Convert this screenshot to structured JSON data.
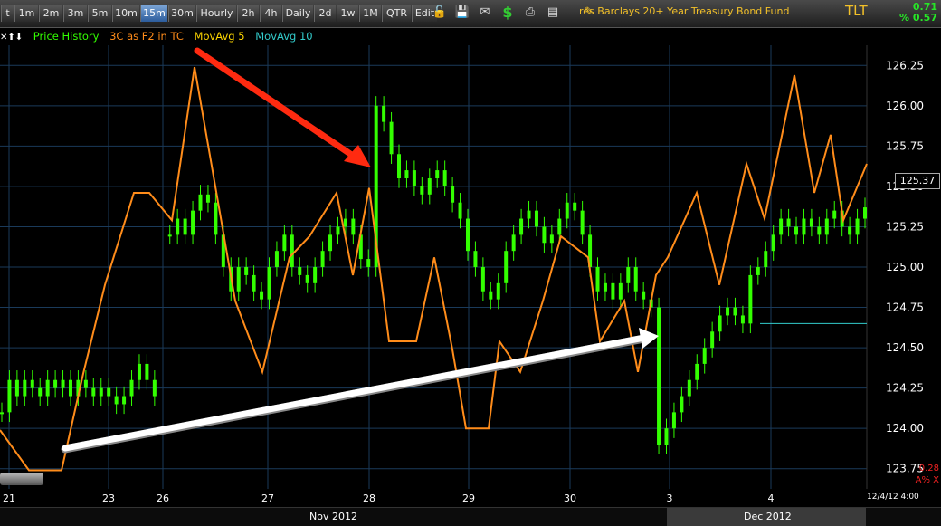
{
  "toolbar": {
    "timeframes": [
      "t",
      "1m",
      "2m",
      "3m",
      "5m",
      "10m",
      "15m",
      "30m",
      "Hourly",
      "2h",
      "4h",
      "Daily",
      "2d",
      "1w",
      "1M",
      "QTR",
      "Edit"
    ],
    "active": "15m",
    "icons": [
      "lock-icon",
      "save-icon",
      "mail-icon",
      "dollar-icon",
      "print-icon",
      "page-icon",
      "pencil-icon"
    ],
    "fund_name": "res Barclays 20+ Year Treasury Bond Fund",
    "symbol": "TLT",
    "change_value": "0.71",
    "change_percent": "% 0.57"
  },
  "legend": {
    "arrows": "✕⬆⬇",
    "price": "Price History",
    "indicator": "3C as F2 in TC",
    "ma5": "MovAvg 5",
    "ma10": "MovAvg 10"
  },
  "colors": {
    "price_up": "#33ff00",
    "indicator": "#ff8c1a",
    "ma5": "#ffd700",
    "ma10": "#33cccc",
    "grid": "#1a3a5a",
    "red_arrow": "#ff2a10",
    "white_arrow": "#ffffff"
  },
  "chart_data": {
    "type": "line",
    "y_ticks": [
      "126.25",
      "126.00",
      "125.75",
      "125.50",
      "125.25",
      "125.00",
      "124.75",
      "124.50",
      "124.25",
      "124.00",
      "123.75"
    ],
    "ylim": [
      123.625,
      126.375
    ],
    "x_ticks": [
      "21",
      "23",
      "26",
      "27",
      "28",
      "29",
      "30",
      "3",
      "4"
    ],
    "months": [
      "Nov 2012",
      "Dec 2012"
    ],
    "last_price": "125.37",
    "ma_level": 124.65,
    "timestamp": "12/4/12 4:00",
    "indicator_labels": [
      "0.28",
      "A% X"
    ],
    "price_series": [
      124.1,
      124.3,
      124.2,
      124.3,
      124.25,
      124.2,
      124.3,
      124.25,
      124.3,
      124.2,
      124.3,
      124.25,
      124.2,
      124.25,
      124.2,
      124.15,
      124.2,
      124.3,
      124.4,
      124.3,
      124.2,
      null,
      125.2,
      125.3,
      125.2,
      125.35,
      125.45,
      125.4,
      125.2,
      125.0,
      124.85,
      125.0,
      124.95,
      124.85,
      124.8,
      125.0,
      125.1,
      125.2,
      125.0,
      124.95,
      124.9,
      125.0,
      125.1,
      125.2,
      125.25,
      125.3,
      125.2,
      125.05,
      125.0,
      126.0,
      125.9,
      125.7,
      125.55,
      125.6,
      125.5,
      125.45,
      125.55,
      125.6,
      125.5,
      125.4,
      125.3,
      125.1,
      125.0,
      124.85,
      124.8,
      124.9,
      125.1,
      125.2,
      125.3,
      125.35,
      125.25,
      125.15,
      125.2,
      125.3,
      125.4,
      125.35,
      125.2,
      125.0,
      124.85,
      124.9,
      124.8,
      124.9,
      125.0,
      124.85,
      124.8,
      124.75,
      123.9,
      124.0,
      124.1,
      124.2,
      124.3,
      124.4,
      124.5,
      124.6,
      124.7,
      124.75,
      124.7,
      124.65,
      124.95,
      125.0,
      125.1,
      125.2,
      125.3,
      125.25,
      125.2,
      125.3,
      125.25,
      125.2,
      125.3,
      125.35,
      125.25,
      125.2,
      125.3,
      125.37
    ],
    "indicator_series": [
      {
        "x": 0,
        "v": 123.99
      },
      {
        "x": 32,
        "v": 123.74
      },
      {
        "x": 68,
        "v": 123.74
      },
      {
        "x": 92,
        "v": 124.34
      },
      {
        "x": 116,
        "v": 124.89
      },
      {
        "x": 148,
        "v": 125.46
      },
      {
        "x": 165,
        "v": 125.46
      },
      {
        "x": 190,
        "v": 125.29
      },
      {
        "x": 215,
        "v": 126.24
      },
      {
        "x": 260,
        "v": 124.79
      },
      {
        "x": 290,
        "v": 124.35
      },
      {
        "x": 320,
        "v": 125.06
      },
      {
        "x": 342,
        "v": 125.19
      },
      {
        "x": 372,
        "v": 125.46
      },
      {
        "x": 390,
        "v": 124.95
      },
      {
        "x": 408,
        "v": 125.49
      },
      {
        "x": 430,
        "v": 124.54
      },
      {
        "x": 460,
        "v": 124.54
      },
      {
        "x": 480,
        "v": 125.06
      },
      {
        "x": 500,
        "v": 124.49
      },
      {
        "x": 515,
        "v": 124.0
      },
      {
        "x": 540,
        "v": 124.0
      },
      {
        "x": 552,
        "v": 124.54
      },
      {
        "x": 575,
        "v": 124.35
      },
      {
        "x": 600,
        "v": 124.79
      },
      {
        "x": 620,
        "v": 125.19
      },
      {
        "x": 650,
        "v": 125.06
      },
      {
        "x": 663,
        "v": 124.54
      },
      {
        "x": 690,
        "v": 124.79
      },
      {
        "x": 705,
        "v": 124.35
      },
      {
        "x": 725,
        "v": 124.95
      },
      {
        "x": 738,
        "v": 125.06
      },
      {
        "x": 770,
        "v": 125.46
      },
      {
        "x": 795,
        "v": 124.89
      },
      {
        "x": 825,
        "v": 125.64
      },
      {
        "x": 845,
        "v": 125.3
      },
      {
        "x": 878,
        "v": 126.19
      },
      {
        "x": 900,
        "v": 125.46
      },
      {
        "x": 918,
        "v": 125.82
      },
      {
        "x": 932,
        "v": 125.29
      },
      {
        "x": 958,
        "v": 125.64
      }
    ]
  }
}
